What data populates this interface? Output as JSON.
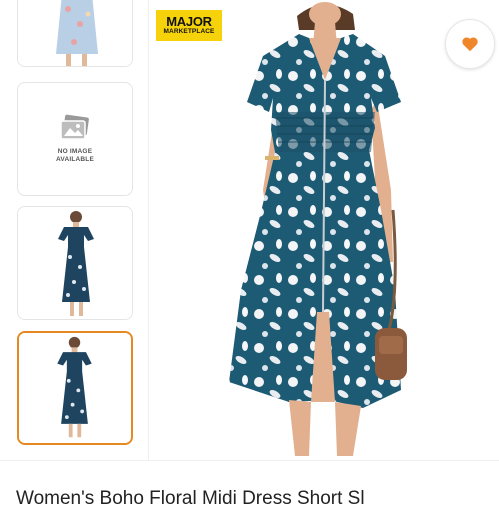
{
  "gallery": {
    "thumbnails": [
      {
        "kind": "photo",
        "alt": "Light blue floral dress thumbnail",
        "selected": false
      },
      {
        "kind": "placeholder",
        "text": "NO IMAGE\nAVAILABLE",
        "selected": false
      },
      {
        "kind": "photo",
        "alt": "Navy floral dress thumbnail",
        "selected": false
      },
      {
        "kind": "photo",
        "alt": "Navy floral dress thumbnail",
        "selected": true
      }
    ],
    "selected_border_color": "#e58a22"
  },
  "badge": {
    "line1": "MAJOR",
    "line2": "MARKETPLACE",
    "color": "#f5d20a"
  },
  "favorite": {
    "icon": "heart-icon",
    "color": "#f0862a"
  },
  "product": {
    "title": "Women's Boho Floral Midi Dress Short Sl",
    "dress_color": "#1d5b74"
  }
}
